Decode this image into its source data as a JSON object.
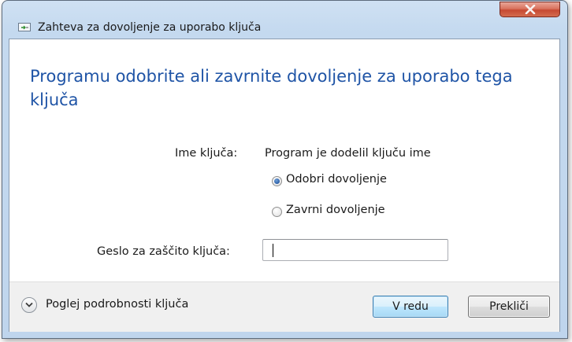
{
  "window": {
    "title": "Zahteva za dovoljenje za uporabo ključa",
    "close_label": "X"
  },
  "main": {
    "heading": "Programu odobrite ali zavrnite dovoljenje za uporabo tega ključa",
    "key_name_label": "Ime ključa:",
    "key_name_value": "Program je dodelil ključu ime",
    "radio_options": [
      {
        "label": "Odobri dovoljenje",
        "checked": true
      },
      {
        "label": "Zavrni dovoljenje",
        "checked": false
      }
    ],
    "password_label": "Geslo za zaščito ključa:",
    "password_value": ""
  },
  "footer": {
    "details_label": "Poglej podrobnosti ključa",
    "ok_label": "V redu",
    "cancel_label": "Prekliči"
  },
  "colors": {
    "heading": "#1f54a6",
    "ok_border": "#3c7fb1",
    "close_button": "#c64a33"
  },
  "icons": {
    "title": "key-window-icon",
    "close": "close-icon",
    "expand": "chevron-down-icon"
  }
}
